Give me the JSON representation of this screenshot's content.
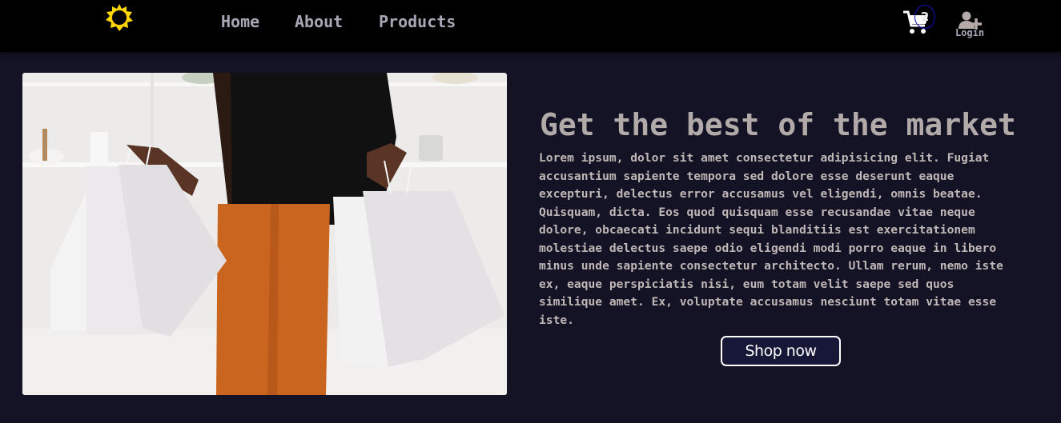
{
  "nav": {
    "logo_icon": "sun-icon",
    "links": [
      "Home",
      "About",
      "Products"
    ],
    "cart_icon": "shopping-cart-icon",
    "cart_count": "2",
    "login_icon": "user-plus-icon",
    "login_label": "Login"
  },
  "hero": {
    "image": "woman-holding-shopping-bags",
    "title": "Get the best of the market",
    "description": "Lorem ipsum, dolor sit amet consectetur adipisicing elit. Fugiat accusantium sapiente tempora sed dolore esse deserunt eaque excepturi, delectus error accusamus vel eligendi, omnis beatae. Quisquam, dicta. Eos quod quisquam esse recusandae vitae neque dolore, obcaecati incidunt sequi blanditiis est exercitationem molestiae delectus saepe odio eligendi modi porro eaque in libero minus unde sapiente consectetur architecto. Ullam rerum, nemo iste ex, eaque perspiciatis nisi, eum totam velit saepe sed quos similique amet. Ex, voluptate accusamus nesciunt totam vitae esse iste.",
    "cta_label": "Shop now"
  },
  "colors": {
    "background": "#131325",
    "nav": "#000000",
    "logo": "#ffd700",
    "button": "#171738"
  }
}
